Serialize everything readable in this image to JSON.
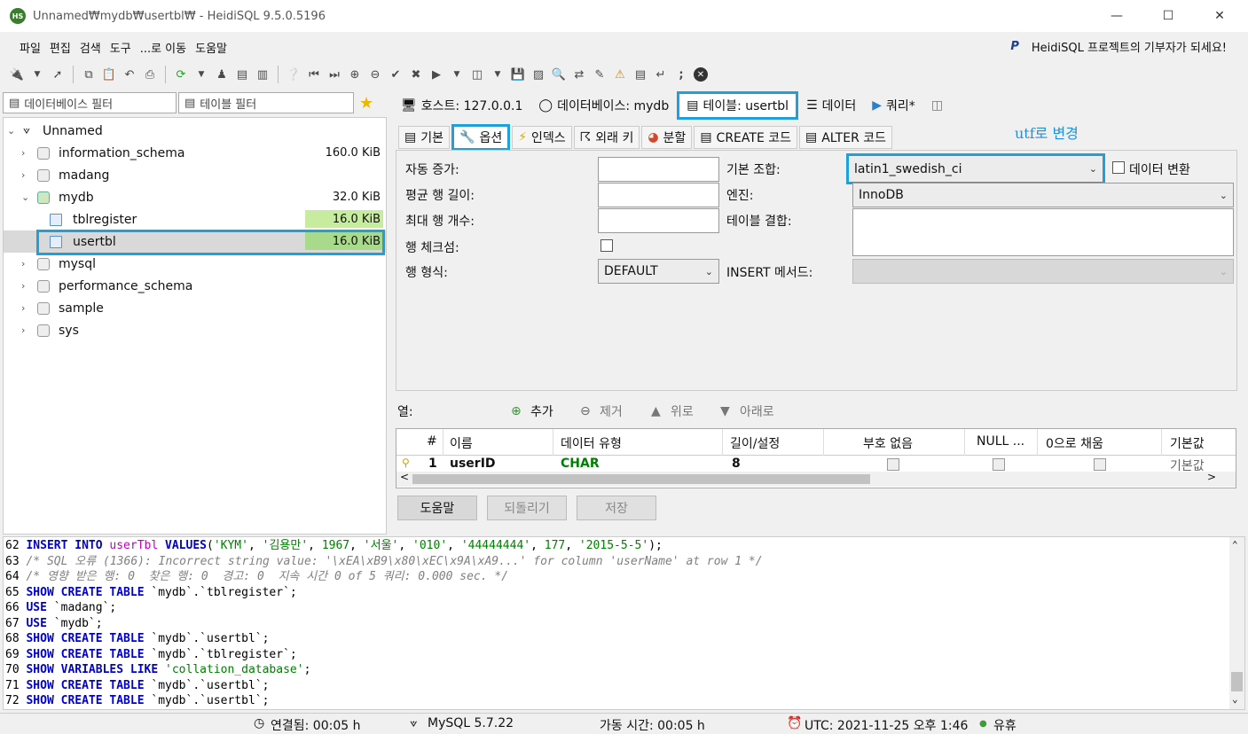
{
  "window": {
    "title": "Unnamed₩mydb₩usertbl₩ - HeidiSQL 9.5.0.5196",
    "app_icon": "HS"
  },
  "menu": {
    "items": [
      "파일",
      "편집",
      "검색",
      "도구",
      "...로 이동",
      "도움말"
    ],
    "donate": "HeidiSQL 프로젝트의 기부자가 되세요!"
  },
  "filters": {
    "db_filter": "데이터베이스 필터",
    "table_filter": "테이블 필터"
  },
  "tree": {
    "root": "Unnamed",
    "items": [
      {
        "label": "information_schema",
        "size": "160.0 KiB"
      },
      {
        "label": "madang",
        "size": ""
      },
      {
        "label": "mydb",
        "size": "32.0 KiB"
      },
      {
        "label": "tblregister",
        "size": "16.0 KiB"
      },
      {
        "label": "usertbl",
        "size": "16.0 KiB"
      },
      {
        "label": "mysql",
        "size": ""
      },
      {
        "label": "performance_schema",
        "size": ""
      },
      {
        "label": "sample",
        "size": ""
      },
      {
        "label": "sys",
        "size": ""
      }
    ]
  },
  "main_tabs": {
    "host": "호스트: 127.0.0.1",
    "database": "데이터베이스: mydb",
    "table": "테이블: usertbl",
    "data": "데이터",
    "query": "쿼리*"
  },
  "sub_tabs": {
    "basic": "기본",
    "options": "옵션",
    "indexes": "인덱스",
    "foreign": "외래 키",
    "partition": "분할",
    "create": "CREATE 코드",
    "alter": "ALTER 코드"
  },
  "annotation": "utf로 변경",
  "options": {
    "auto_inc_label": "자동 증가:",
    "avg_row_label": "평균 행 길이:",
    "max_rows_label": "최대 행 개수:",
    "checksum_label": "행 체크섬:",
    "row_format_label": "행 형식:",
    "row_format_value": "DEFAULT",
    "collation_label": "기본 조합:",
    "collation_value": "latin1_swedish_ci",
    "convert_label": "데이터 변환",
    "engine_label": "엔진:",
    "engine_value": "InnoDB",
    "union_label": "테이블 결합:",
    "insert_method_label": "INSERT 메서드:"
  },
  "columns_bar": {
    "label": "열:",
    "add": "추가",
    "remove": "제거",
    "up": "위로",
    "down": "아래로"
  },
  "grid": {
    "headers": [
      "#",
      "이름",
      "데이터 유형",
      "길이/설정",
      "부호 없음",
      "NULL ...",
      "0으로 채움",
      "기본값"
    ],
    "row": {
      "num": "1",
      "name": "userID",
      "type": "CHAR",
      "length": "8",
      "default": "기본값"
    }
  },
  "buttons": {
    "help": "도움말",
    "revert": "되돌리기",
    "save": "저장"
  },
  "sql_log": [
    {
      "n": "62",
      "parts": [
        [
          "kw",
          "INSERT INTO "
        ],
        [
          "tbl",
          "userTbl"
        ],
        [
          "kw",
          " VALUES"
        ],
        [
          "ln",
          "("
        ],
        [
          "str",
          "'KYM'"
        ],
        [
          "ln",
          ", "
        ],
        [
          "str",
          "'김용만'"
        ],
        [
          "ln",
          ", "
        ],
        [
          "str",
          "1967"
        ],
        [
          "ln",
          ", "
        ],
        [
          "str",
          "'서울'"
        ],
        [
          "ln",
          ", "
        ],
        [
          "str",
          "'010'"
        ],
        [
          "ln",
          ", "
        ],
        [
          "str",
          "'44444444'"
        ],
        [
          "ln",
          ", "
        ],
        [
          "str",
          "177"
        ],
        [
          "ln",
          ", "
        ],
        [
          "str",
          "'2015-5-5'"
        ],
        [
          "ln",
          ");"
        ]
      ]
    },
    {
      "n": "63",
      "parts": [
        [
          "cmt",
          "/* SQL 오류 (1366): Incorrect string value: '\\xEA\\xB9\\x80\\xEC\\x9A\\xA9...' for column 'userName' at row 1 */"
        ]
      ]
    },
    {
      "n": "64",
      "parts": [
        [
          "cmt",
          "/* 영향 받은 행: 0  찾은 행: 0  경고: 0  지속 시간 0 of 5 쿼리: 0.000 sec. */"
        ]
      ]
    },
    {
      "n": "65",
      "parts": [
        [
          "kw",
          "SHOW CREATE TABLE "
        ],
        [
          "ln",
          "`mydb`.`tblregister`;"
        ]
      ]
    },
    {
      "n": "66",
      "parts": [
        [
          "kw",
          "USE "
        ],
        [
          "ln",
          "`madang`;"
        ]
      ]
    },
    {
      "n": "67",
      "parts": [
        [
          "kw",
          "USE "
        ],
        [
          "ln",
          "`mydb`;"
        ]
      ]
    },
    {
      "n": "68",
      "parts": [
        [
          "kw",
          "SHOW CREATE TABLE "
        ],
        [
          "ln",
          "`mydb`.`usertbl`;"
        ]
      ]
    },
    {
      "n": "69",
      "parts": [
        [
          "kw",
          "SHOW CREATE TABLE "
        ],
        [
          "ln",
          "`mydb`.`tblregister`;"
        ]
      ]
    },
    {
      "n": "70",
      "parts": [
        [
          "kw",
          "SHOW VARIABLES LIKE "
        ],
        [
          "str",
          "'collation_database'"
        ],
        [
          "ln",
          ";"
        ]
      ]
    },
    {
      "n": "71",
      "parts": [
        [
          "kw",
          "SHOW CREATE TABLE "
        ],
        [
          "ln",
          "`mydb`.`usertbl`;"
        ]
      ]
    },
    {
      "n": "72",
      "parts": [
        [
          "kw",
          "SHOW CREATE TABLE "
        ],
        [
          "ln",
          "`mydb`.`usertbl`;"
        ]
      ]
    }
  ],
  "status": {
    "connected": "연결됨: 00:05 h",
    "server": "MySQL 5.7.22",
    "uptime": "가동 시간: 00:05 h",
    "utc": "UTC: 2021-11-25 오후 1:46",
    "idle": "유휴"
  },
  "colors": {
    "highlight": "#1ea0dc",
    "size_bar": "#c7eca0",
    "keyword": "#0000d0",
    "string": "#008000",
    "comment": "#808080"
  }
}
